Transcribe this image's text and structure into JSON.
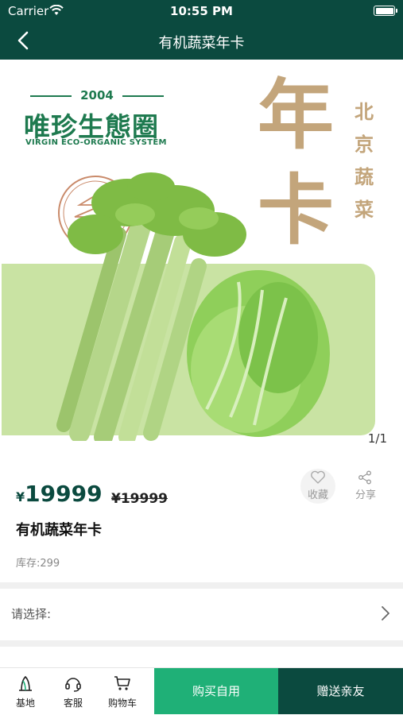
{
  "status_bar": {
    "carrier": "Carrier",
    "time": "10:55 PM"
  },
  "nav": {
    "title": "有机蔬菜年卡"
  },
  "banner": {
    "logo_year": "2004",
    "logo_cn": "唯珍生態圈",
    "logo_en": "VIRGIN ECO-ORGANIC SYSTEM",
    "big_year": "年",
    "big_card": "卡",
    "side_text": [
      "北",
      "京",
      "蔬",
      "菜"
    ],
    "page_indicator": "1/1",
    "panel_color": "#c9e3a3",
    "accent_gold": "#c3a57b"
  },
  "product": {
    "currency": "¥",
    "price": "19999",
    "old_price": "¥19999",
    "name": "有机蔬菜年卡",
    "stock": "库存:299",
    "favorite_label": "收藏",
    "share_label": "分享"
  },
  "select": {
    "label": "请选择:"
  },
  "bottom": {
    "tabs": [
      {
        "label": "基地",
        "icon": "plant-icon"
      },
      {
        "label": "客服",
        "icon": "headset-icon"
      },
      {
        "label": "购物车",
        "icon": "cart-icon"
      }
    ],
    "buy_self": "购买自用",
    "gift": "赠送亲友"
  },
  "colors": {
    "primary": "#0b4a3f",
    "buy_green": "#1fb077"
  }
}
